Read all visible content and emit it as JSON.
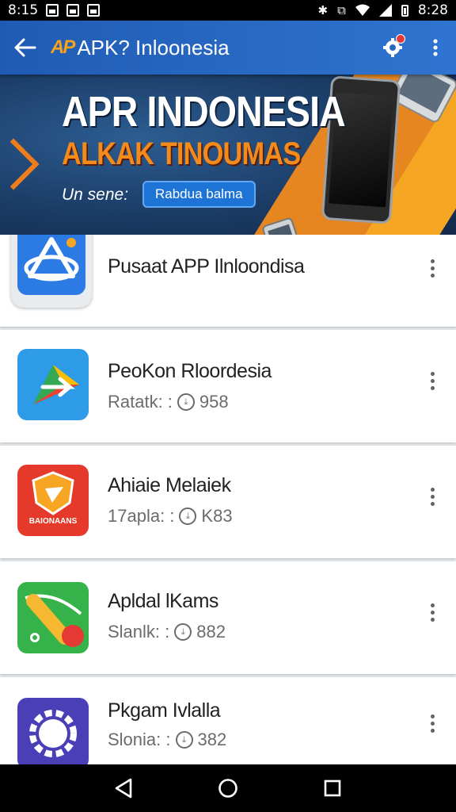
{
  "status_bar": {
    "time_left": "8:15",
    "time_right": "8:28"
  },
  "app_bar": {
    "logo": "AP",
    "title": "APK? Inloonesia"
  },
  "banner": {
    "headline": "APR INDONESIA",
    "subheadline": "ALKAK TINOUMAS",
    "tagline": "Un sene:",
    "cta_label": "Rabdua balma"
  },
  "apps": [
    {
      "name": "Pusaat APP Ilnloondisa",
      "meta_label": "",
      "meta_value": "",
      "icon": "triangle-a-icon",
      "icon_bg": "#2c7be5"
    },
    {
      "name": "PeoKon Rloordesia",
      "meta_label": "Ratatk: :",
      "meta_value": "958",
      "icon": "arrow-play-icon",
      "icon_bg": "#2d9be8"
    },
    {
      "name": "Ahiaie Melaiek",
      "meta_label": "17apla: :",
      "meta_value": "K83",
      "icon": "shield-star-icon",
      "icon_bg": "#e53a2b",
      "icon_text": "BAIONAANS"
    },
    {
      "name": "Apldal lKams",
      "meta_label": "Slanlk: :",
      "meta_value": "882",
      "icon": "pin-path-icon",
      "icon_bg": "#35b34a"
    },
    {
      "name": "Pkgam Ivlalla",
      "meta_label": "Slonia: :",
      "meta_value": "382",
      "icon": "gear-compass-icon",
      "icon_bg": "#4b3fb8"
    }
  ],
  "colors": {
    "app_bar": "#2468c4",
    "accent_orange": "#f28a1c"
  }
}
